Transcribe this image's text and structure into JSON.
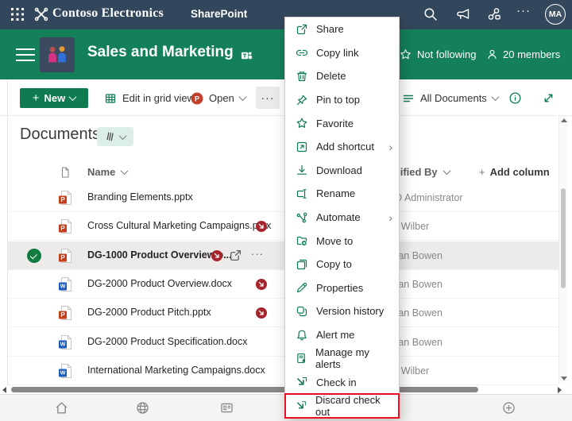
{
  "topbar": {
    "brand": "Contoso Electronics",
    "product": "SharePoint",
    "more_label": "···",
    "avatar_initials": "MA"
  },
  "site": {
    "title": "Sales and Marketing",
    "follow_label": "Not following",
    "members_label": "20 members"
  },
  "toolbar": {
    "new_label": "New",
    "new_plus": "+",
    "edit_grid_label": "Edit in grid view",
    "open_label": "Open",
    "open_file_letter": "P",
    "more_label": "···",
    "view_label": "All Documents"
  },
  "heading": {
    "title": "Documents"
  },
  "table": {
    "columns": {
      "name": "Name",
      "modified_by": "Modified By",
      "add_plus": "+",
      "add_column": "Add column"
    },
    "rows": [
      {
        "name": "Branding Elements.pptx",
        "type": "pptx",
        "modified_by": "MOD Administrator",
        "checked_out": false,
        "selected": false
      },
      {
        "name": "Cross Cultural Marketing Campaigns.pptx",
        "type": "pptx",
        "modified_by": "Alex Wilber",
        "checked_out": true,
        "selected": false
      },
      {
        "name": "DG-1000 Product Overview.p...",
        "type": "pptx",
        "modified_by": "Megan Bowen",
        "checked_out": true,
        "selected": true,
        "row_more_label": "···"
      },
      {
        "name": "DG-2000 Product Overview.docx",
        "type": "docx",
        "modified_by": "Megan Bowen",
        "checked_out": true,
        "selected": false
      },
      {
        "name": "DG-2000 Product Pitch.pptx",
        "type": "pptx",
        "modified_by": "Megan Bowen",
        "checked_out": true,
        "selected": false
      },
      {
        "name": "DG-2000 Product Specification.docx",
        "type": "docx",
        "modified_by": "Megan Bowen",
        "checked_out": false,
        "selected": false
      },
      {
        "name": "International Marketing Campaigns.docx",
        "type": "docx",
        "modified_by": "Alex Wilber",
        "checked_out": false,
        "selected": false
      }
    ],
    "file_letters": {
      "pptx": "P",
      "docx": "W"
    }
  },
  "menu": {
    "items": [
      {
        "label": "Share"
      },
      {
        "label": "Copy link"
      },
      {
        "label": "Delete"
      },
      {
        "label": "Pin to top"
      },
      {
        "label": "Favorite"
      },
      {
        "label": "Add shortcut",
        "submenu": "›"
      },
      {
        "label": "Download"
      },
      {
        "label": "Rename"
      },
      {
        "label": "Automate",
        "submenu": "›"
      },
      {
        "label": "Move to"
      },
      {
        "label": "Copy to"
      },
      {
        "label": "Properties"
      },
      {
        "label": "Version history"
      },
      {
        "label": "Alert me"
      },
      {
        "label": "Manage my alerts"
      },
      {
        "label": "Check in"
      },
      {
        "label": "Discard check out",
        "highlighted": true
      }
    ]
  },
  "bottombar": {
    "icons": [
      "home",
      "globe",
      "news",
      "add"
    ]
  },
  "icons": {
    "checked_out_badge": "red circle with white down-right arrow",
    "selected_check": "green circle with white checkmark"
  },
  "colors": {
    "topbar": "#33475C",
    "band_green": "#14805A",
    "button_green": "#0F7B50",
    "accent_green": "#0E7C52",
    "pptx_red": "#C43E1C",
    "docx_blue": "#185ABD",
    "checked_out_red": "#A4262C",
    "selected_row": "#EDEBE9",
    "highlight_red": "#E81123"
  }
}
